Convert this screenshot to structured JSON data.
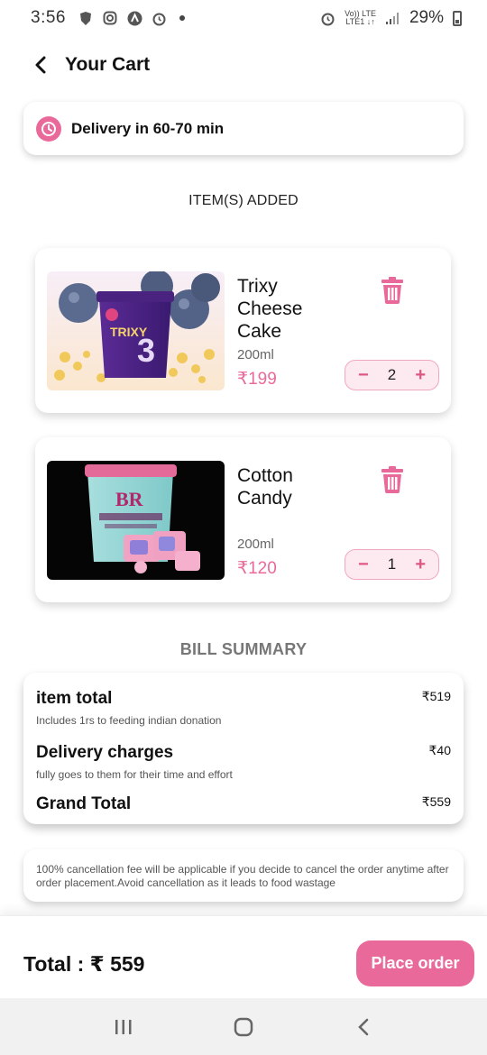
{
  "status_bar": {
    "time": "3:56",
    "net_top": "Vo)) LTE",
    "net_bottom": "LTE1 ↓↑",
    "battery": "29%"
  },
  "header": {
    "title": "Your Cart",
    "back_icon": "chevron-left-icon"
  },
  "delivery": {
    "text": "Delivery in 60-70 min",
    "icon": "clock-icon"
  },
  "items_heading": "ITEM(S) ADDED",
  "items": [
    {
      "name": "Trixy Cheese Cake",
      "size": "200ml",
      "price": "₹199",
      "quantity": "2",
      "decrement": "−",
      "increment": "+",
      "image": "trixy-cheesecake-tub"
    },
    {
      "name": "Cotton Candy",
      "size": "200ml",
      "price": "₹120",
      "quantity": "1",
      "decrement": "−",
      "increment": "+",
      "image": "br-cotton-candy-tub"
    }
  ],
  "bill_heading": "BILL SUMMARY",
  "bill": {
    "item_total": {
      "label": "item total",
      "sub": "Includes 1rs to feeding indian donation",
      "amount": "₹519"
    },
    "delivery": {
      "label": "Delivery charges",
      "sub": "fully goes to them for their time and effort",
      "amount": "₹40"
    },
    "grand_total": {
      "label": "Grand Total",
      "amount": "₹559"
    }
  },
  "note": "100% cancellation fee will be applicable if you decide to cancel the order anytime after order placement.Avoid cancellation as it leads to food wastage",
  "footer": {
    "total": "Total : ₹ 559",
    "place_order": "Place order"
  },
  "colors": {
    "accent": "#e96a9a",
    "stepper_bg": "#fde9f0",
    "nav_bg": "#f1f1f1"
  }
}
